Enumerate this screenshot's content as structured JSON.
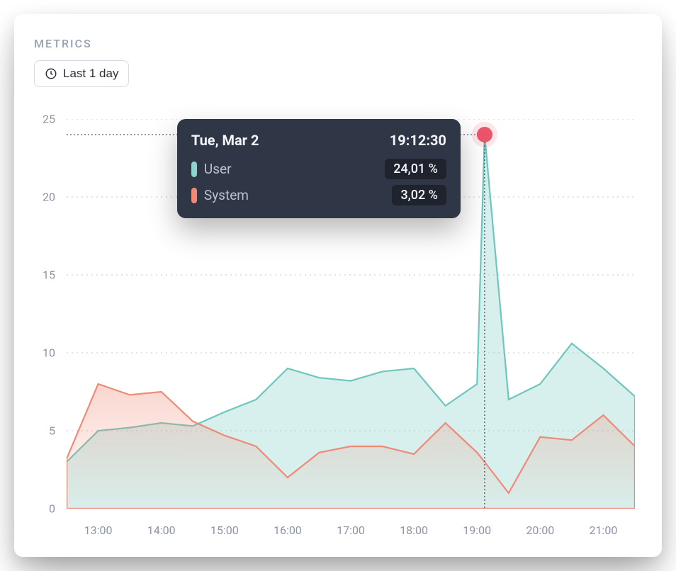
{
  "header": {
    "title": "METRICS",
    "range_label": "Last 1 day"
  },
  "tooltip": {
    "date": "Tue, Mar 2",
    "time": "19:12:30",
    "rows": [
      {
        "label": "User",
        "value": "24,01 %",
        "swatchClass": "user"
      },
      {
        "label": "System",
        "value": "3,02 %",
        "swatchClass": "system"
      }
    ]
  },
  "chart_data": {
    "type": "area",
    "xlabel": "",
    "ylabel": "",
    "ylim": [
      0,
      25
    ],
    "x_tick_labels": [
      "13:00",
      "14:00",
      "15:00",
      "16:00",
      "17:00",
      "18:00",
      "19:00",
      "20:00",
      "21:00"
    ],
    "y_ticks": [
      0,
      5,
      10,
      15,
      20,
      25
    ],
    "x": [
      12.5,
      13.0,
      13.5,
      14.0,
      14.5,
      15.0,
      15.5,
      16.0,
      16.5,
      17.0,
      17.5,
      18.0,
      18.5,
      19.0,
      19.12,
      19.5,
      20.0,
      20.5,
      21.0,
      21.5
    ],
    "series": [
      {
        "name": "User",
        "color": "#6FC6BC",
        "values": [
          3.0,
          5.0,
          5.2,
          5.5,
          5.3,
          6.2,
          7.0,
          9.0,
          8.4,
          8.2,
          8.8,
          9.0,
          6.6,
          8.0,
          24.0,
          7.0,
          8.0,
          10.6,
          9.0,
          7.2
        ]
      },
      {
        "name": "System",
        "color": "#F08A77",
        "values": [
          3.2,
          8.0,
          7.3,
          7.5,
          5.6,
          4.7,
          4.0,
          2.0,
          3.6,
          4.0,
          4.0,
          3.5,
          5.5,
          3.6,
          3.0,
          1.0,
          4.6,
          4.4,
          6.0,
          4.0
        ]
      }
    ],
    "highlight_x": 19.12,
    "highlight_y": 24.0
  }
}
